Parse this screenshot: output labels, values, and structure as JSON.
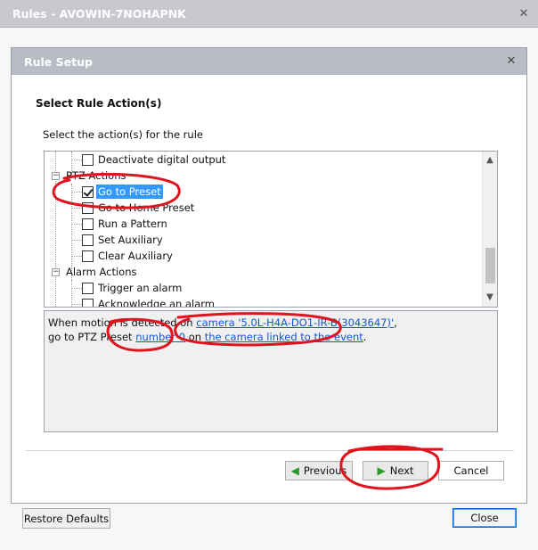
{
  "window": {
    "title": "Rules - AVOWIN-7NOHAPNK",
    "close_glyph": "✕"
  },
  "dialog": {
    "title": "Rule Setup",
    "close_glyph": "✕",
    "section_title": "Select Rule Action(s)",
    "instruction": "Select the action(s) for the rule"
  },
  "tree": {
    "items": [
      {
        "label": "Deactivate digital output",
        "checked": false,
        "group": false
      },
      {
        "label": "PTZ Actions",
        "group": true
      },
      {
        "label": "Go to Preset",
        "checked": true,
        "selected": true,
        "group": false
      },
      {
        "label": "Go to Home Preset",
        "checked": false,
        "group": false
      },
      {
        "label": "Run a Pattern",
        "checked": false,
        "group": false
      },
      {
        "label": "Set Auxiliary",
        "checked": false,
        "group": false
      },
      {
        "label": "Clear Auxiliary",
        "checked": false,
        "group": false
      },
      {
        "label": "Alarm Actions",
        "group": true
      },
      {
        "label": "Trigger an alarm",
        "checked": false,
        "group": false
      },
      {
        "label": "Acknowledge an alarm",
        "checked": false,
        "group": false
      }
    ],
    "expander_glyph": "−"
  },
  "description": {
    "line1_prefix": "When motion is detected on ",
    "camera_link": "camera '5.0L-H4A-DO1-IR-B(3043647)'",
    "line1_suffix": ",",
    "line2_prefix": "go to PTZ Preset ",
    "preset_link": "number 0",
    "line2_middle": " on ",
    "linked_camera_link": "the camera linked to the event",
    "line2_suffix": "."
  },
  "buttons": {
    "previous": "Previous",
    "next": "Next",
    "cancel": "Cancel",
    "restore_defaults": "Restore Defaults",
    "close": "Close"
  },
  "colors": {
    "annotation_red": "#e0141e",
    "selection_blue": "#3399ff",
    "link_blue": "#1458c4",
    "arrow_green": "#2a9a2a"
  }
}
